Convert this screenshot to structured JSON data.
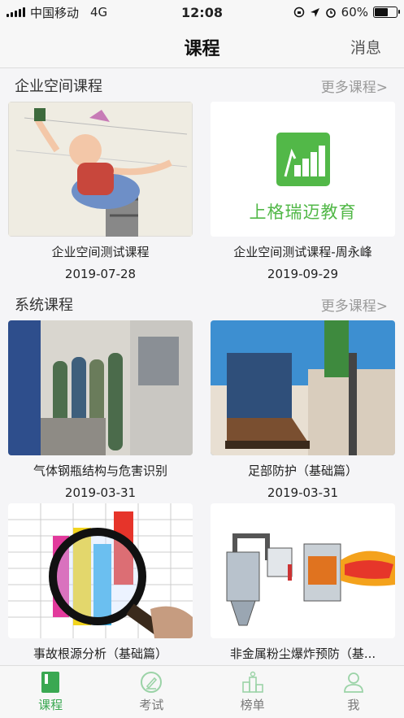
{
  "status_bar": {
    "carrier": "中国移动",
    "network": "4G",
    "time": "12:08",
    "battery": "60%"
  },
  "nav": {
    "title": "课程",
    "right_label": "消息"
  },
  "sections": [
    {
      "title": "企业空间课程",
      "more": "更多课程>",
      "courses": [
        {
          "title": "企业空间测试课程",
          "date": "2019-07-28"
        },
        {
          "title": "企业空间测试课程-周永峰",
          "date": "2019-09-29",
          "logo_text": "上格瑞迈教育"
        }
      ]
    },
    {
      "title": "系统课程",
      "more": "更多课程>",
      "courses": [
        {
          "title": "气体钢瓶结构与危害识别",
          "date": "2019-03-31"
        },
        {
          "title": "足部防护（基础篇）",
          "date": "2019-03-31"
        },
        {
          "title": "事故根源分析（基础篇）",
          "date": ""
        },
        {
          "title": "非金属粉尘爆炸预防（基...",
          "date": ""
        }
      ]
    }
  ],
  "tabs": [
    {
      "label": "课程",
      "icon": "book-icon",
      "active": true
    },
    {
      "label": "考试",
      "icon": "pen-icon",
      "active": false
    },
    {
      "label": "榜单",
      "icon": "podium-icon",
      "active": false
    },
    {
      "label": "我",
      "icon": "user-icon",
      "active": false
    }
  ],
  "colors": {
    "accent": "#3aa852",
    "logo_green": "#52b848"
  }
}
